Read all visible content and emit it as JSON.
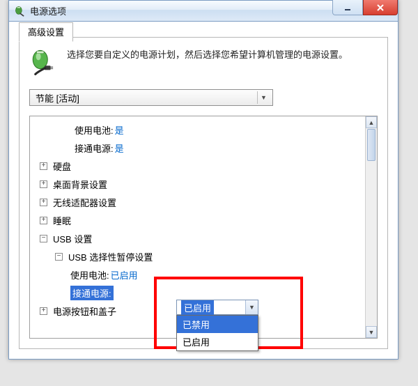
{
  "window": {
    "title": "电源选项"
  },
  "tab": {
    "label": "高级设置"
  },
  "explain": "选择您要自定义的电源计划，然后选择您希望计算机管理的电源设置。",
  "plan": {
    "selected": "节能 [活动]"
  },
  "nodes": {
    "battery_label": "使用电池:",
    "battery_value": "是",
    "ac_label": "接通电源:",
    "ac_value": "是",
    "hdd": "硬盘",
    "desktop_bg": "桌面背景设置",
    "wireless": "无线适配器设置",
    "sleep": "睡眠",
    "usb": "USB 设置",
    "usb_suspend": "USB 选择性暂停设置",
    "usb_batt_label": "使用电池:",
    "usb_batt_value": "已启用",
    "usb_ac_label": "接通电源:",
    "usb_ac_value": "已启用",
    "power_btn": "电源按钮和盖子"
  },
  "dropdown": {
    "selected": "已启用",
    "opt_disabled": "已禁用",
    "opt_enabled": "已启用"
  },
  "icons": {
    "plus": "+",
    "minus": "−"
  }
}
